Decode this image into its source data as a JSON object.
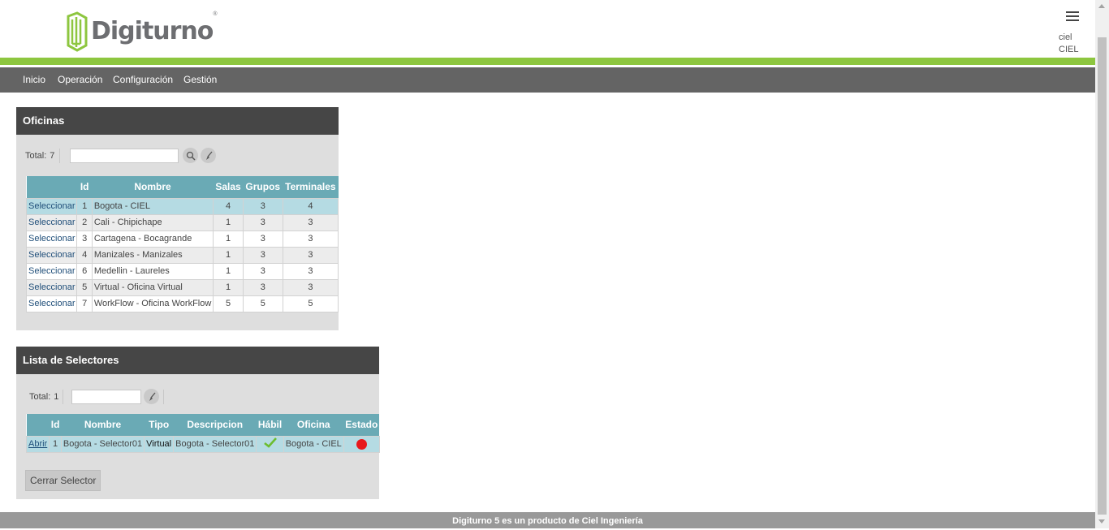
{
  "brand": {
    "name": "Digiturno",
    "reg_mark": "®",
    "accent": "#8dc63f"
  },
  "user": {
    "login": "ciel",
    "company": "CIEL"
  },
  "nav": {
    "items": [
      "Inicio",
      "Operación",
      "Configuración",
      "Gestión"
    ]
  },
  "oficinas": {
    "title": "Oficinas",
    "total_label": "Total:",
    "total": "7",
    "search_value": "",
    "columns": [
      "",
      "Id",
      "Nombre",
      "Salas",
      "Grupos",
      "Terminales"
    ],
    "select_label": "Seleccionar",
    "rows": [
      {
        "id": "1",
        "nombre": "Bogota - CIEL",
        "salas": "4",
        "grupos": "3",
        "terminales": "4"
      },
      {
        "id": "2",
        "nombre": "Cali - Chipichape",
        "salas": "1",
        "grupos": "3",
        "terminales": "3"
      },
      {
        "id": "3",
        "nombre": "Cartagena - Bocagrande",
        "salas": "1",
        "grupos": "3",
        "terminales": "3"
      },
      {
        "id": "4",
        "nombre": "Manizales - Manizales",
        "salas": "1",
        "grupos": "3",
        "terminales": "3"
      },
      {
        "id": "6",
        "nombre": "Medellin - Laureles",
        "salas": "1",
        "grupos": "3",
        "terminales": "3"
      },
      {
        "id": "5",
        "nombre": "Virtual - Oficina Virtual",
        "salas": "1",
        "grupos": "3",
        "terminales": "3"
      },
      {
        "id": "7",
        "nombre": "WorkFlow - Oficina WorkFlow",
        "salas": "5",
        "grupos": "5",
        "terminales": "5"
      }
    ]
  },
  "selectores": {
    "title": "Lista de Selectores",
    "total_label": "Total:",
    "total": "1",
    "filter_value": "",
    "columns": [
      "",
      "Id",
      "Nombre",
      "Tipo",
      "Descripcion",
      "Hábil",
      "Oficina",
      "Estado"
    ],
    "rows": [
      {
        "action": "Abrir",
        "id": "1",
        "nombre": "Bogota - Selector01",
        "tipo": "Virtual",
        "descripcion": "Bogota - Selector01",
        "habil": "check-icon",
        "oficina": "Bogota - CIEL",
        "estado": "red-dot"
      }
    ],
    "close_button": "Cerrar Selector"
  },
  "footer": {
    "text": "Digiturno 5 es un producto de Ciel Ingeniería"
  },
  "colors": {
    "header_bar": "#646464",
    "panel_title": "#464646",
    "table_header": "#6aaab5",
    "selected_row": "#b5dbe3",
    "status_red": "#e8191c"
  }
}
